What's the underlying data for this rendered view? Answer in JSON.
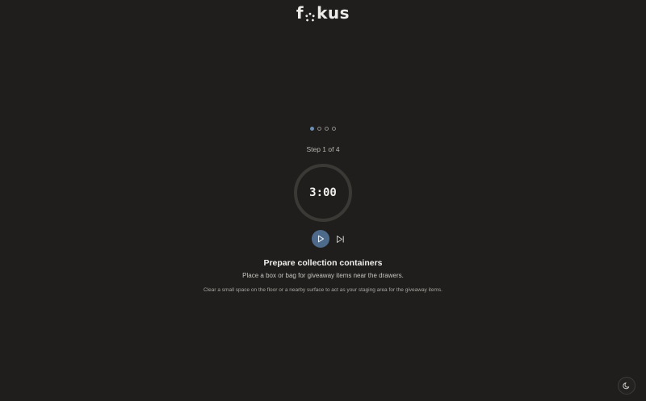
{
  "app": {
    "logo_text_start": "f",
    "logo_text_end": "kus"
  },
  "progress": {
    "total_steps": 4,
    "current_step": 1,
    "step_label": "Step 1 of 4"
  },
  "timer": {
    "display": "3:00",
    "progress_fraction": 0
  },
  "controls": {
    "play_icon": "play-icon",
    "skip_icon": "skip-forward-icon"
  },
  "task": {
    "title": "Prepare collection containers",
    "subtitle": "Place a box or bag for giveaway items near the drawers.",
    "description": "Clear a small space on the floor or a nearby surface to act as your staging area for the giveaway items."
  },
  "theme_toggle": {
    "icon": "moon-icon"
  },
  "colors": {
    "background": "#1f1e1d",
    "accent": "#6d8fb4",
    "play_button": "#4d6a8a",
    "timer_ring": "#3a3936"
  }
}
